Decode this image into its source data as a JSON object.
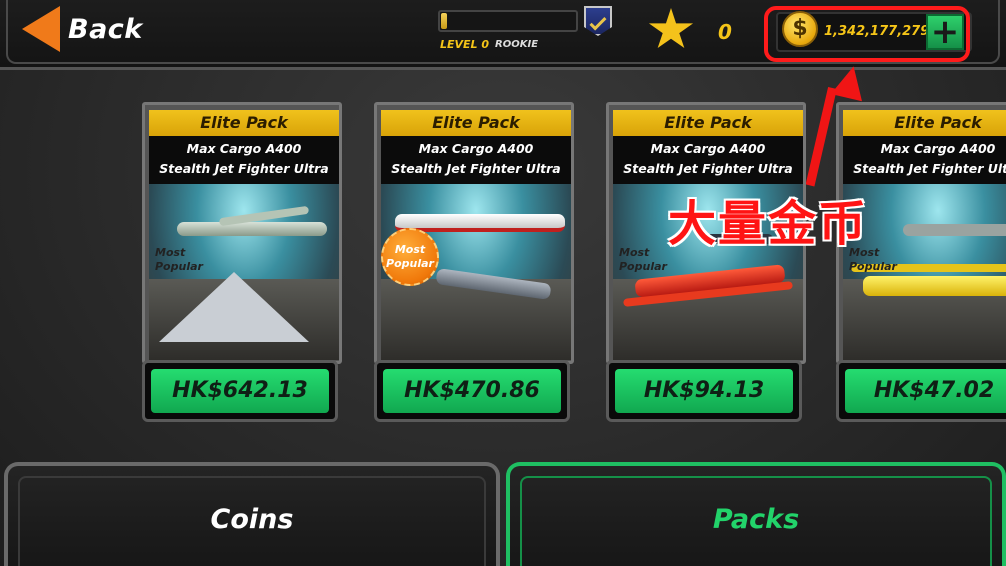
{
  "header": {
    "back_label": "Back",
    "level_label": "LEVEL 0",
    "rank_label": "ROOKIE",
    "level_progress_fraction": 0.04,
    "stars": "0",
    "coins": "1,342,177,279",
    "add_coins_label": "+"
  },
  "annotation": {
    "text": "大量金币",
    "color": "#ff1414"
  },
  "packs": [
    {
      "title": "Elite Pack",
      "line1": "Max Cargo A400",
      "line2": "Stealth Jet Fighter Ultra",
      "popular_line1": "Most",
      "popular_line2": "Popular",
      "price": "HK$642.13"
    },
    {
      "title": "Elite Pack",
      "line1": "Max Cargo A400",
      "line2": "Stealth Jet Fighter Ultra",
      "popular_line1": "Most",
      "popular_line2": "Popular",
      "price": "HK$470.86"
    },
    {
      "title": "Elite Pack",
      "line1": "Max Cargo A400",
      "line2": "Stealth Jet Fighter Ultra",
      "popular_line1": "Most",
      "popular_line2": "Popular",
      "price": "HK$94.13"
    },
    {
      "title": "Elite Pack",
      "line1": "Max Cargo A400",
      "line2": "Stealth Jet Fighter Ultra",
      "popular_line1": "Most",
      "popular_line2": "Popular",
      "price": "HK$47.02"
    }
  ],
  "tabs": {
    "coins_label": "Coins",
    "packs_label": "Packs",
    "active": "Packs"
  },
  "colors": {
    "accent_green": "#1fbf62",
    "gold": "#f5c518",
    "back_orange": "#f07a1a"
  }
}
